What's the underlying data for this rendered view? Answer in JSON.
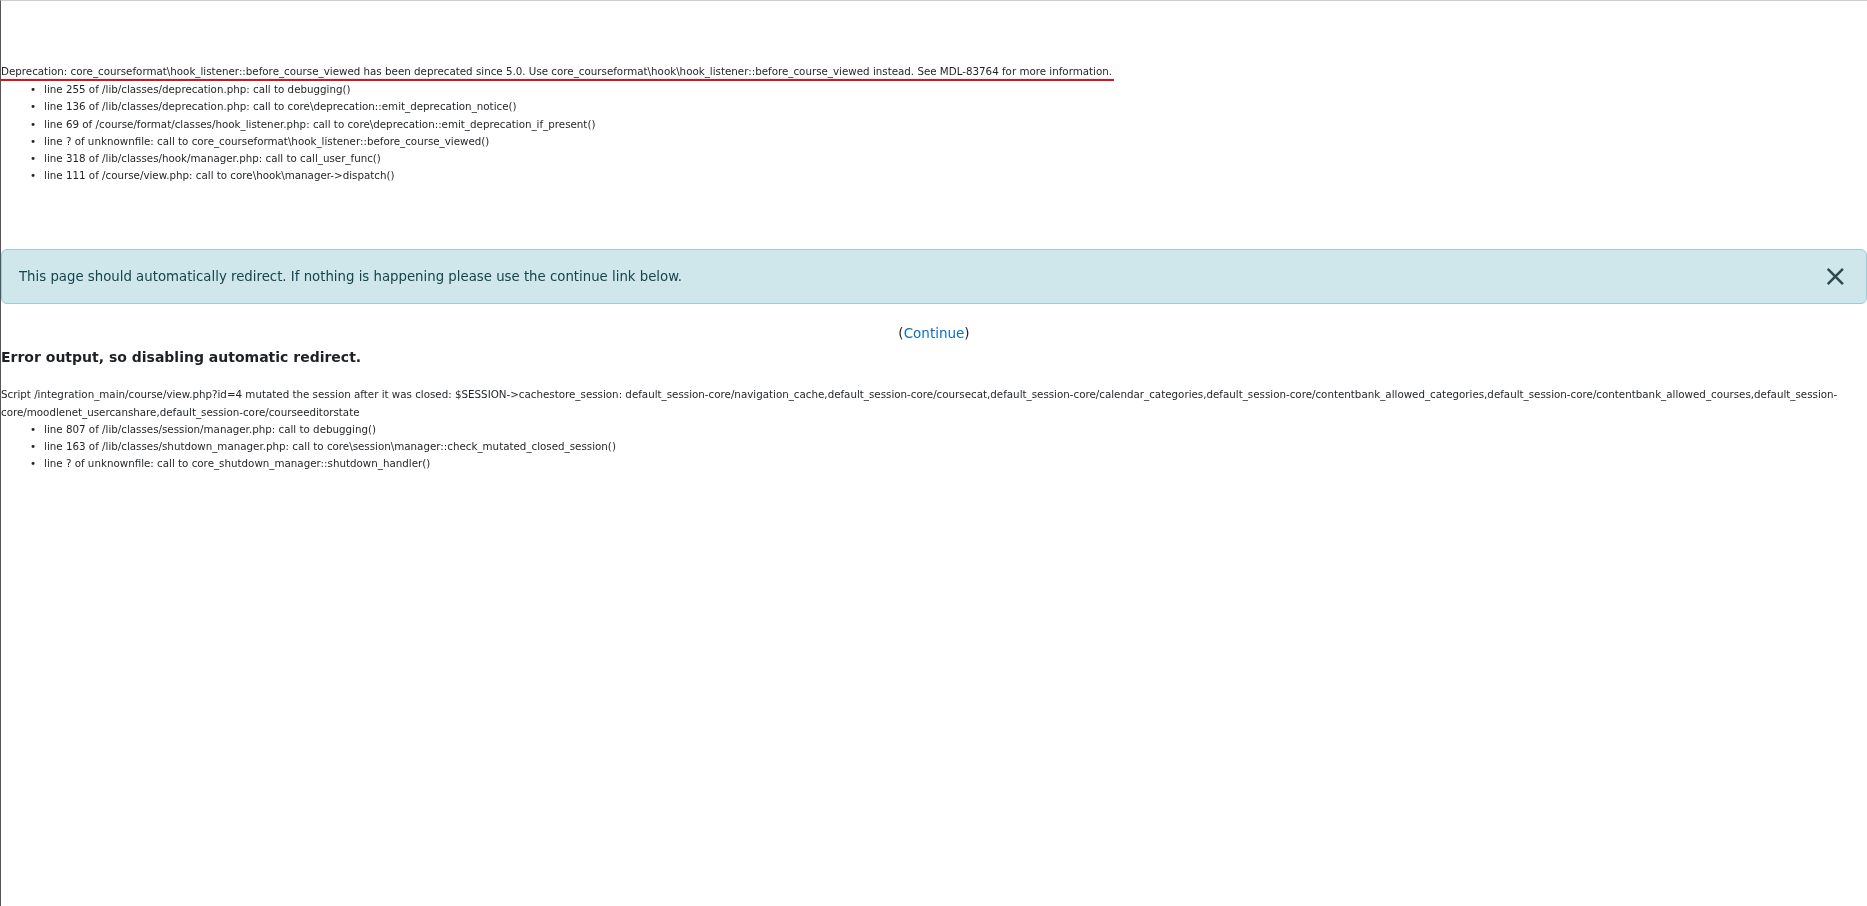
{
  "deprecation": {
    "message": "Deprecation: core_courseformat\\hook_listener::before_course_viewed has been deprecated since 5.0. Use core_courseformat\\hook\\hook_listener::before_course_viewed instead. See MDL-83764 for more information.",
    "trace": [
      {
        "bullet": "•",
        "text": "line 255 of /lib/classes/deprecation.php: call to debugging()"
      },
      {
        "bullet": "•",
        "text": "line 136 of /lib/classes/deprecation.php: call to core\\deprecation::emit_deprecation_notice()"
      },
      {
        "bullet": "•",
        "text": "line 69 of /course/format/classes/hook_listener.php: call to core\\deprecation::emit_deprecation_if_present()"
      },
      {
        "bullet": "•",
        "text": "line ? of unknownfile: call to core_courseformat\\hook_listener::before_course_viewed()"
      },
      {
        "bullet": "•",
        "text": "line 318 of /lib/classes/hook/manager.php: call to call_user_func()"
      },
      {
        "bullet": "•",
        "text": "line 111 of /course/view.php: call to core\\hook\\manager->dispatch()"
      }
    ]
  },
  "alert": {
    "text": "This page should automatically redirect. If nothing is happening please use the continue link below.",
    "close": "×"
  },
  "continue": {
    "before": "(",
    "link": "Continue",
    "after": ")"
  },
  "error_heading": "Error output, so disabling automatic redirect.",
  "session_error": {
    "message": "Script /integration_main/course/view.php?id=4 mutated the session after it was closed: $SESSION->cachestore_session: default_session-core/navigation_cache,default_session-core/coursecat,default_session-core/calendar_categories,default_session-core/contentbank_allowed_categories,default_session-core/contentbank_allowed_courses,default_session-core/moodlenet_usercanshare,default_session-core/courseeditorstate",
    "trace": [
      {
        "bullet": "•",
        "text": "line 807 of /lib/classes/session/manager.php: call to debugging()"
      },
      {
        "bullet": "•",
        "text": "line 163 of /lib/classes/shutdown_manager.php: call to core\\session\\manager::check_mutated_closed_session()"
      },
      {
        "bullet": "•",
        "text": "line ? of unknownfile: call to core_shutdown_manager::shutdown_handler()"
      }
    ]
  }
}
